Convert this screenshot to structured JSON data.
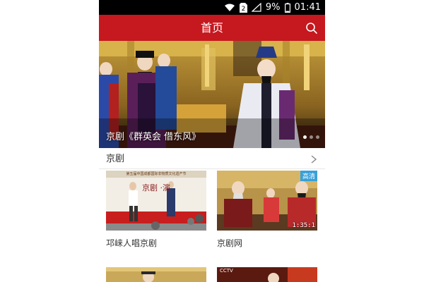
{
  "status_bar": {
    "battery": "9%",
    "time": "01:41",
    "sim_label": "2"
  },
  "header": {
    "title": "首页"
  },
  "banner": {
    "caption": "京剧《群英会 借东风》",
    "slide_count": 3,
    "active_slide": 1
  },
  "section": {
    "title": "京剧"
  },
  "videos": [
    {
      "label": "邛崃人唱京剧",
      "thumb_text": "京剧 ·演",
      "thumb_banner": "第五届中国成都国际非物质文化遗产节"
    },
    {
      "label": "京剧网",
      "badge": "高清",
      "duration": "1:35:1"
    },
    {
      "label": ""
    },
    {
      "label": "",
      "thumb_text": "CCTV"
    }
  ],
  "colors": {
    "header": "#c6181f",
    "status_bar": "#000000",
    "text": "#333333"
  },
  "icons": {
    "search": "search-icon",
    "wifi": "wifi-icon",
    "signal": "signal-icon",
    "battery": "battery-icon",
    "chevron": "chevron-right-icon"
  }
}
